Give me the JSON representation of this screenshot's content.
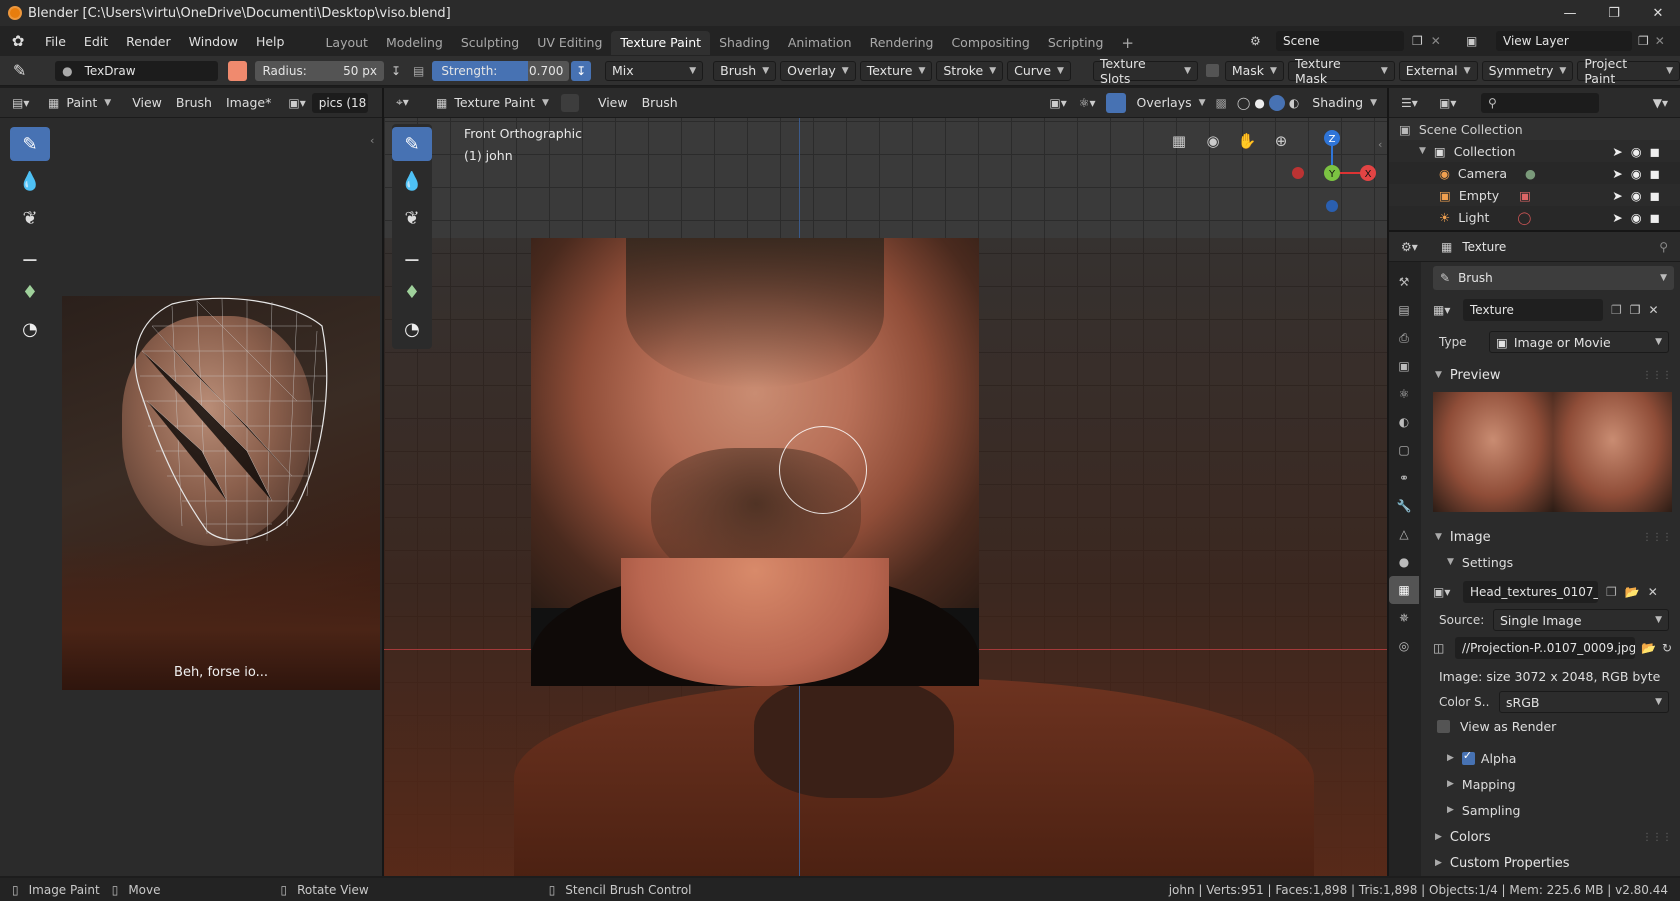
{
  "window": {
    "title": "Blender [C:\\Users\\virtu\\OneDrive\\Documenti\\Desktop\\viso.blend]"
  },
  "menu": [
    "File",
    "Edit",
    "Render",
    "Window",
    "Help"
  ],
  "workspaces": [
    "Layout",
    "Modeling",
    "Sculpting",
    "UV Editing",
    "Texture Paint",
    "Shading",
    "Animation",
    "Rendering",
    "Compositing",
    "Scripting"
  ],
  "active_workspace": "Texture Paint",
  "scene": "Scene",
  "view_layer": "View Layer",
  "tool_settings": {
    "brush_name": "TexDraw",
    "brush_color": "#f08a6e",
    "radius_label": "Radius:",
    "radius_value": "50 px",
    "strength_label": "Strength:",
    "strength_value": "0.700",
    "strength_fraction": 0.7,
    "blend": "Mix",
    "dropdowns": [
      "Brush",
      "Overlay",
      "Texture",
      "Stroke",
      "Curve"
    ],
    "right_dropdowns": [
      "Texture Slots",
      "Mask",
      "Texture Mask",
      "External",
      "Symmetry",
      "Project Paint"
    ]
  },
  "image_editor": {
    "mode": "Paint",
    "menus": [
      "View",
      "Brush",
      "Image*"
    ],
    "image_name": "pics (18",
    "subtitle": "Beh, forse io..."
  },
  "viewport": {
    "mode": "Texture Paint",
    "menus": [
      "View",
      "Brush"
    ],
    "overlays": "Overlays",
    "shading": "Shading",
    "view_name": "Front Orthographic",
    "object_name": "(1) john",
    "gizmo_axes": [
      "Z",
      "Y",
      "X"
    ]
  },
  "outliner": {
    "root": "Scene Collection",
    "collection": "Collection",
    "items": [
      "Camera",
      "Empty",
      "Light"
    ]
  },
  "properties": {
    "context": "Texture",
    "brush": "Brush",
    "texture_name": "Texture",
    "type_label": "Type",
    "type_value": "Image or Movie",
    "preview_label": "Preview",
    "image_label": "Image",
    "settings_label": "Settings",
    "image_name": "Head_textures_0107_...",
    "source_label": "Source:",
    "source_value": "Single Image",
    "filepath": "//Projection-P..0107_0009.jpg",
    "image_info": "Image: size 3072 x 2048, RGB byte",
    "color_space_label": "Color S..",
    "color_space_value": "sRGB",
    "view_as_render": "View as Render",
    "alpha": "Alpha",
    "mapping": "Mapping",
    "sampling": "Sampling",
    "colors": "Colors",
    "custom_properties": "Custom Properties"
  },
  "status_bar": {
    "left": [
      "Image Paint",
      "Move",
      "Rotate View",
      "Stencil Brush Control"
    ],
    "stats": "john | Verts:951 | Faces:1,898 | Tris:1,898 | Objects:1/4 | Mem: 225.6 MB | v2.80.44"
  }
}
